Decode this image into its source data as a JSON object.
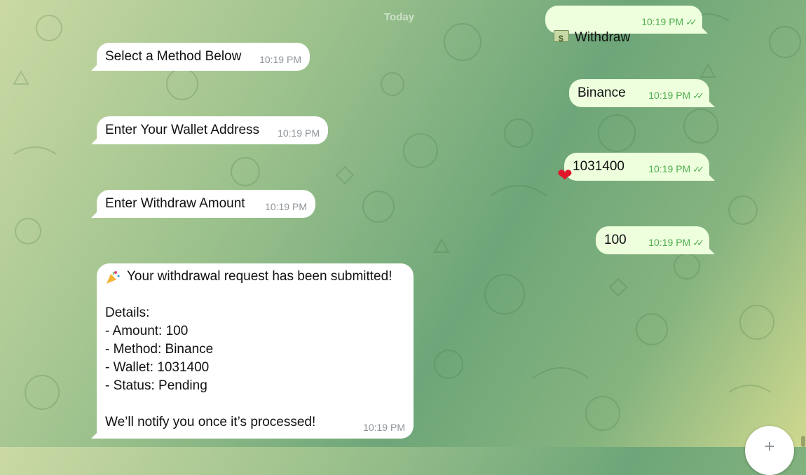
{
  "chat": {
    "date_label": "Today",
    "messages": [
      {
        "dir": "out",
        "icon": "money-icon",
        "text": "Withdraw",
        "time": "10:19 PM",
        "ticks": "✓✓"
      },
      {
        "dir": "in",
        "text": "Select a Method Below",
        "time": "10:19 PM"
      },
      {
        "dir": "out",
        "text": "Binance",
        "time": "10:19 PM",
        "ticks": "✓✓"
      },
      {
        "dir": "in",
        "text": "Enter Your Wallet Address",
        "time": "10:19 PM"
      },
      {
        "dir": "out",
        "text": "1031400",
        "time": "10:19 PM",
        "ticks": "✓✓",
        "reaction": "heart-icon"
      },
      {
        "dir": "in",
        "text": "Enter Withdraw Amount",
        "time": "10:19 PM"
      },
      {
        "dir": "out",
        "text": "100",
        "time": "10:19 PM",
        "ticks": "✓✓"
      },
      {
        "dir": "in",
        "icon": "party-popper-icon",
        "text": "Your withdrawal request has been submitted!\n\nDetails:\n- Amount: 100\n- Method: Binance\n- Wallet: 1031400\n- Status: Pending\n\nWe’ll notify you once it’s processed!",
        "time": "10:19 PM"
      }
    ]
  },
  "reaction_glyph": "❤",
  "fab_glyph": "+",
  "colors": {
    "incoming": "#ffffff",
    "outgoing": "#eeffde",
    "time_out": "#4fae4e",
    "time_in": "#8e9499"
  }
}
